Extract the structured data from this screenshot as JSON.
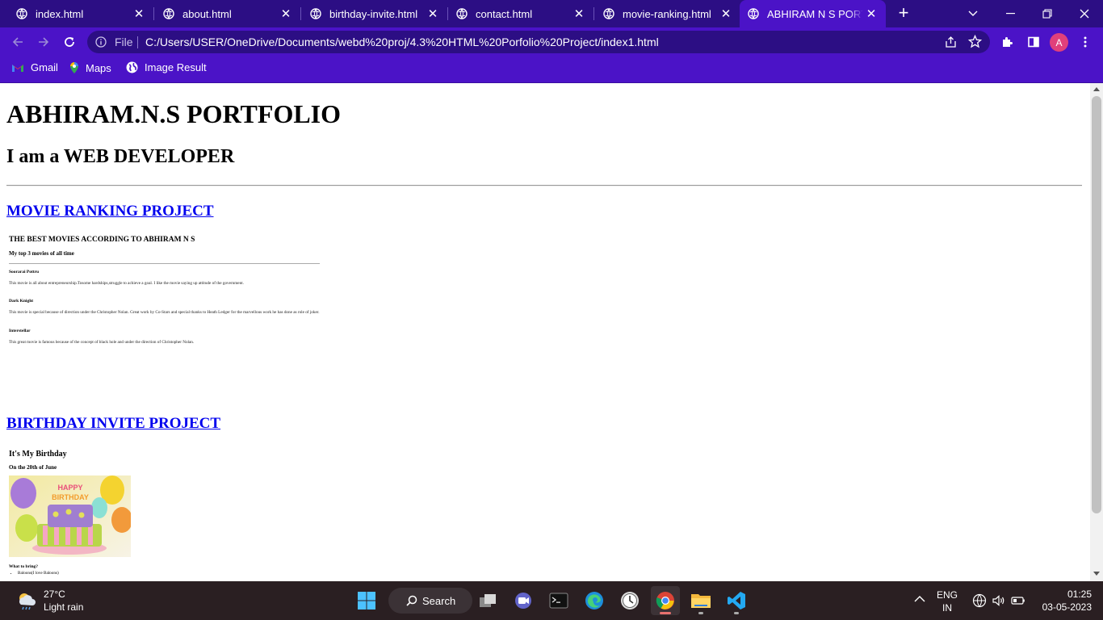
{
  "tabs": [
    {
      "label": "index.html"
    },
    {
      "label": "about.html"
    },
    {
      "label": "birthday-invite.html"
    },
    {
      "label": "contact.html"
    },
    {
      "label": "movie-ranking.html"
    },
    {
      "label": "ABHIRAM N S PORTFOLIO",
      "active": true
    }
  ],
  "new_tab_symbol": "+",
  "close_symbol": "✕",
  "address": {
    "scheme_label": "File",
    "url": "C:/Users/USER/OneDrive/Documents/webd%20proj/4.3%20HTML%20Porfolio%20Project/index1.html"
  },
  "profile_initial": "A",
  "bookmarks": [
    {
      "label": "Gmail",
      "icon": "gmail-icon"
    },
    {
      "label": "Maps",
      "icon": "maps-icon"
    },
    {
      "label": "Image Result",
      "icon": "globe-icon"
    }
  ],
  "page": {
    "title": "ABHIRAM.N.S PORTFOLIO",
    "subtitle": "I am a WEB DEVELOPER",
    "projects": [
      {
        "link": "MOVIE RANKING PROJECT",
        "heading": "THE BEST MOVIES ACCORDING TO ABHIRAM N S",
        "subheading": "My top 3 movies of all time",
        "movies": [
          {
            "title": "Soorarai Pottru",
            "desc": "This movie is all about entrepreneurship.Tosome hardships,struggle to achieve a goal. I like the movie saying up attitude of the government."
          },
          {
            "title": "Dark Knight",
            "desc": "This movie is special because of direction under the Christopher Nolan. Great work by Co-Stars and special thanks to Heath Ledger for the marvellous work he has done as role of joker."
          },
          {
            "title": "Interstellar",
            "desc": "This great movie is famous because of the concept of black hole and under the direction of Christopher Nolan."
          }
        ]
      },
      {
        "link": "BIRTHDAY INVITE PROJECT",
        "heading": "It's My Birthday",
        "subheading": "On the 20th of June",
        "image_alt": "birthday cake",
        "bring_heading": "What to bring?",
        "bring_items": [
          "Baloons(I love Baloons)"
        ]
      }
    ]
  },
  "taskbar": {
    "weather_temp": "27°C",
    "weather_desc": "Light rain",
    "search_label": "Search",
    "apps": [
      "start-icon",
      "task-view-icon",
      "teams-icon",
      "terminal-icon",
      "edge-icon",
      "clock-app-icon",
      "chrome-icon",
      "file-explorer-icon",
      "vscode-icon"
    ],
    "lang_top": "ENG",
    "lang_bottom": "IN",
    "time": "01:25",
    "date": "03-05-2023"
  },
  "colors": {
    "tabstrip": "#2c0e84",
    "toolbar": "#4b13c7",
    "link": "#0000ee",
    "taskbar": "#2a1f22"
  }
}
